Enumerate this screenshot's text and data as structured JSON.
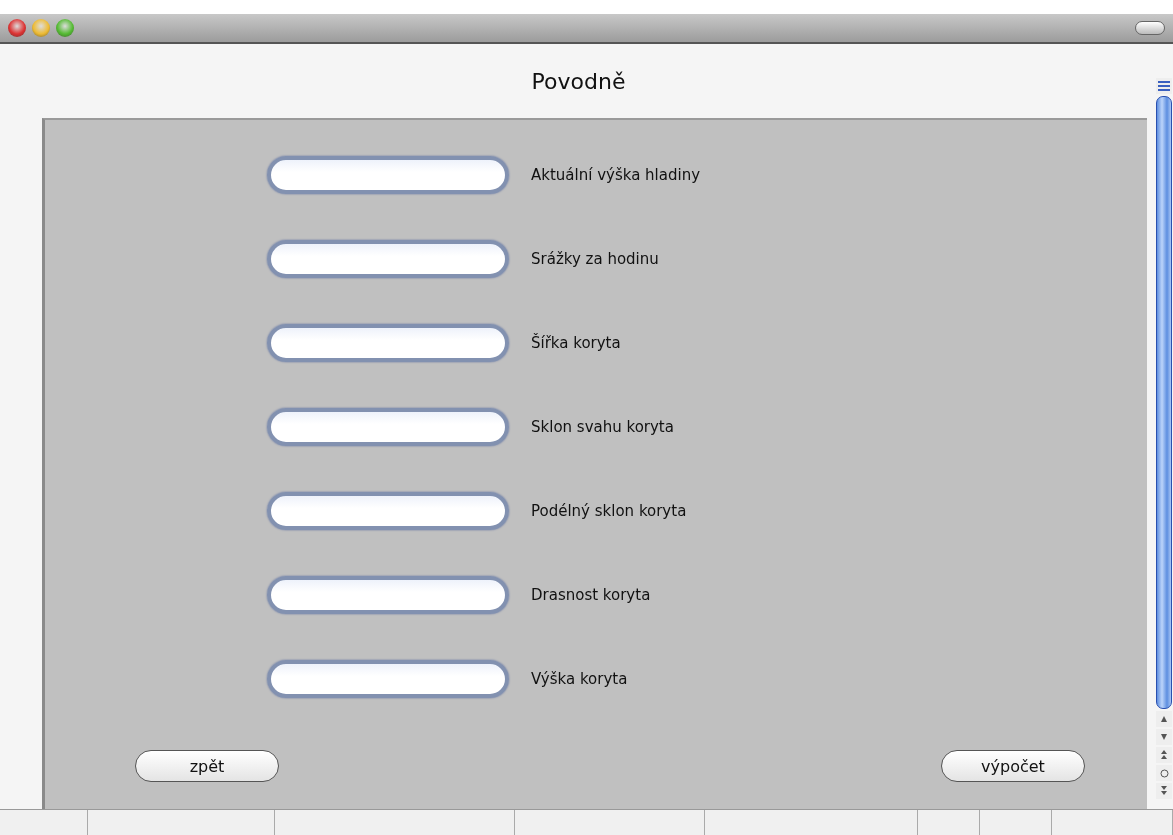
{
  "window": {
    "title": "Povodně"
  },
  "fields": [
    {
      "label": "Aktuální výška hladiny"
    },
    {
      "label": "Srážky za hodinu"
    },
    {
      "label": "Šířka koryta"
    },
    {
      "label": "Sklon svahu koryta"
    },
    {
      "label": "Podélný sklon koryta"
    },
    {
      "label": "Drasnost koryta"
    },
    {
      "label": "Výška koryta"
    }
  ],
  "buttons": {
    "back": "zpět",
    "calculate": "výpočet"
  }
}
